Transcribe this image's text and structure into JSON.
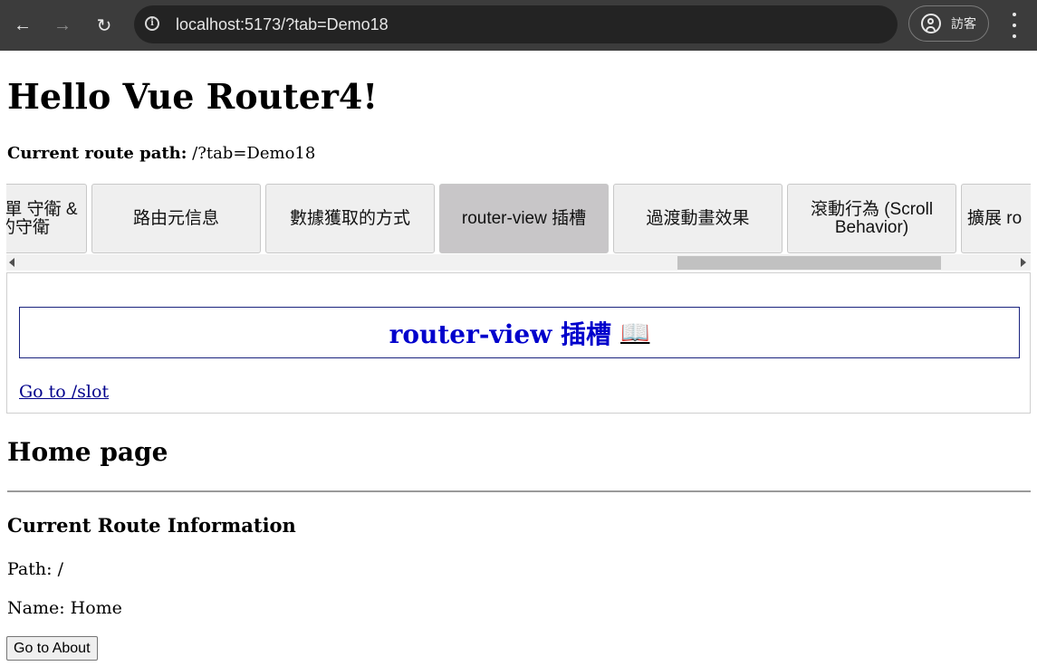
{
  "browser": {
    "url": "localhost:5173/?tab=Demo18",
    "profile_label": "訪客"
  },
  "page": {
    "title": "Hello Vue Router4!",
    "route_path_label": "Current route path:",
    "route_path_value": " /?tab=Demo18"
  },
  "tabs": [
    {
      "label": "針對單 守衛 & 的守衛"
    },
    {
      "label": "路由元信息"
    },
    {
      "label": "數據獲取的方式"
    },
    {
      "label": "router-view 插槽",
      "active": true
    },
    {
      "label": "過渡動畫效果"
    },
    {
      "label": "滾動行為 (Scroll Behavior)"
    },
    {
      "label": "擴展 ro"
    }
  ],
  "panel": {
    "slot_title": "router-view 插槽",
    "book_icon": "📖",
    "link_text": "Go to /slot"
  },
  "home": {
    "heading": "Home page",
    "info_heading": "Current Route Information",
    "path_text": "Path: /",
    "name_text": "Name: Home",
    "button_label": "Go to About"
  }
}
